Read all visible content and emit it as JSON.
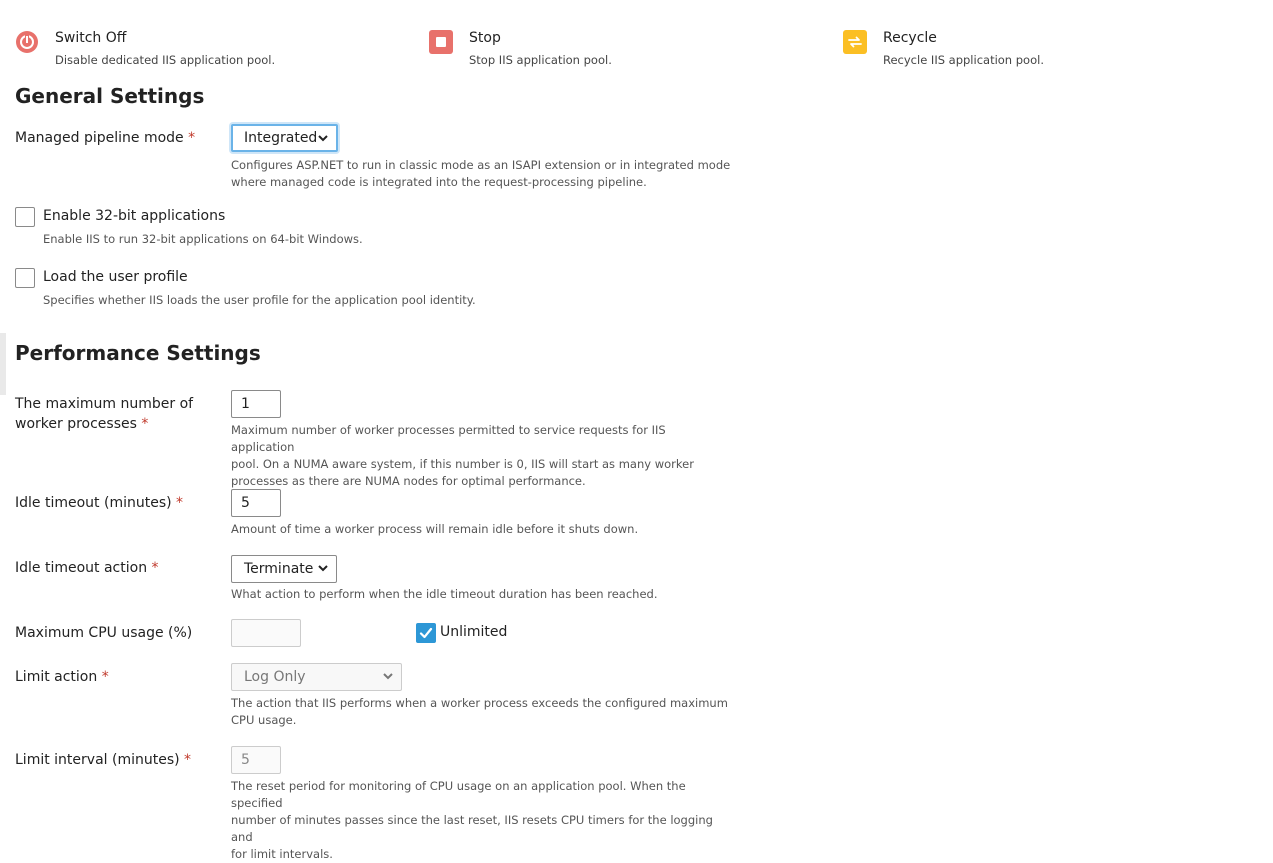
{
  "actions": [
    {
      "icon": "power-icon",
      "color": "#e8716b",
      "title": "Switch Off",
      "desc": "Disable dedicated IIS application pool."
    },
    {
      "icon": "stop-icon",
      "color": "#e8716b",
      "title": "Stop",
      "desc": "Stop IIS application pool."
    },
    {
      "icon": "recycle-icon",
      "color": "#fbbf24",
      "title": "Recycle",
      "desc": "Recycle IIS application pool."
    }
  ],
  "general": {
    "heading": "General Settings",
    "pipeline": {
      "label": "Managed pipeline mode",
      "required": "*",
      "value": "Integrated",
      "hint_line1": "Configures ASP.NET to run in classic mode as an ISAPI extension or in integrated mode",
      "hint_line2": "where managed code is integrated into the request-processing pipeline."
    },
    "enable32": {
      "label": "Enable 32-bit applications",
      "checked": false,
      "hint": "Enable IIS to run 32-bit applications on 64-bit Windows."
    },
    "loadProfile": {
      "label": "Load the user profile",
      "checked": false,
      "hint": "Specifies whether IIS loads the user profile for the application pool identity."
    }
  },
  "performance": {
    "heading": "Performance Settings",
    "maxProcesses": {
      "label_line1": "The maximum number of",
      "label_line2": "worker processes",
      "required": "*",
      "value": "1",
      "hint_line1": "Maximum number of worker processes permitted to service requests for IIS application",
      "hint_line2": "pool. On a NUMA aware system, if this number is 0, IIS will start as many worker",
      "hint_line3": "processes as there are NUMA nodes for optimal performance."
    },
    "idleTimeout": {
      "label": "Idle timeout (minutes)",
      "required": "*",
      "value": "5",
      "hint": "Amount of time a worker process will remain idle before it shuts down."
    },
    "idleAction": {
      "label": "Idle timeout action",
      "required": "*",
      "value": "Terminate",
      "hint": "What action to perform when the idle timeout duration has been reached."
    },
    "maxCpu": {
      "label": "Maximum CPU usage (%)",
      "value": "",
      "unlimited_label": "Unlimited",
      "unlimited_checked": true
    },
    "limitAction": {
      "label": "Limit action",
      "required": "*",
      "value": "Log Only",
      "hint_line1": "The action that IIS performs when a worker process exceeds the configured maximum",
      "hint_line2": "CPU usage."
    },
    "limitInterval": {
      "label": "Limit interval (minutes)",
      "required": "*",
      "value": "5",
      "hint_line1": "The reset period for monitoring of CPU usage on an application pool. When the specified",
      "hint_line2": "number of minutes passes since the last reset, IIS resets CPU timers for the logging and",
      "hint_line3": "for limit intervals."
    }
  }
}
